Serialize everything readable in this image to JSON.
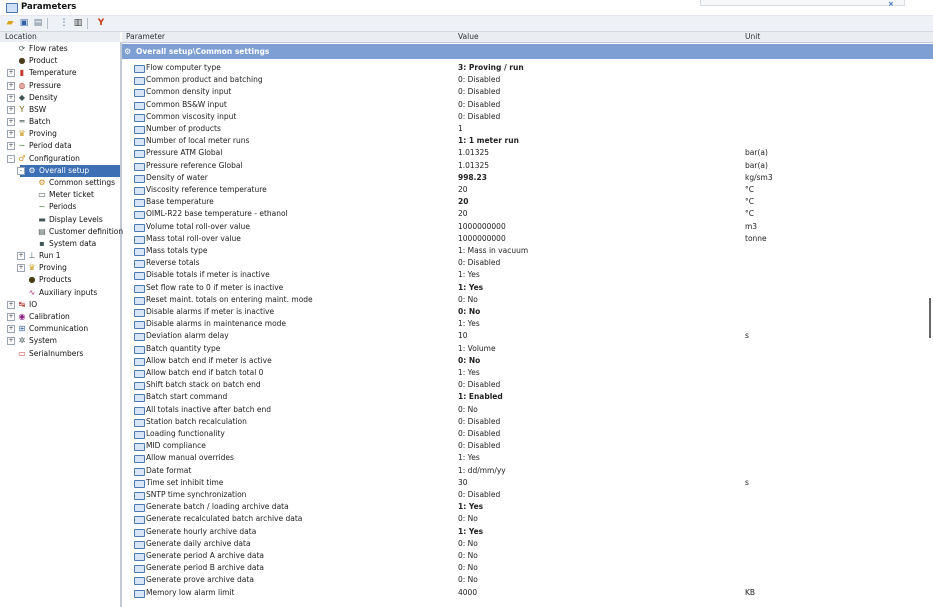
{
  "window": {
    "title": "Parameters"
  },
  "toolbar": {
    "icons": [
      "open-folder-icon",
      "save-icon",
      "print-icon",
      "tree-view-icon",
      "columns-icon",
      "filter-clear-icon"
    ]
  },
  "columns": {
    "location": "Location",
    "parameter": "Parameter",
    "value": "Value",
    "unit": "Unit"
  },
  "tree": [
    {
      "label": "Flow rates",
      "indent": 0,
      "exp": "",
      "icon": "flow-icon"
    },
    {
      "label": "Product",
      "indent": 0,
      "exp": "",
      "icon": "drop-icon"
    },
    {
      "label": "Temperature",
      "indent": 0,
      "exp": "+",
      "icon": "thermometer-icon"
    },
    {
      "label": "Pressure",
      "indent": 0,
      "exp": "+",
      "icon": "gauge-icon"
    },
    {
      "label": "Density",
      "indent": 0,
      "exp": "+",
      "icon": "density-icon"
    },
    {
      "label": "BSW",
      "indent": 0,
      "exp": "+",
      "icon": "funnel-icon"
    },
    {
      "label": "Batch",
      "indent": 0,
      "exp": "+",
      "icon": "batch-icon"
    },
    {
      "label": "Proving",
      "indent": 0,
      "exp": "+",
      "icon": "trophy-icon"
    },
    {
      "label": "Period data",
      "indent": 0,
      "exp": "+",
      "icon": "period-icon"
    },
    {
      "label": "Configuration",
      "indent": 0,
      "exp": "-",
      "icon": "config-icon"
    },
    {
      "label": "Overall setup",
      "indent": 1,
      "exp": "-",
      "icon": "setup-icon",
      "selected": true
    },
    {
      "label": "Common settings",
      "indent": 2,
      "exp": "",
      "icon": "settings-icon"
    },
    {
      "label": "Meter ticket",
      "indent": 2,
      "exp": "",
      "icon": "ticket-icon"
    },
    {
      "label": "Periods",
      "indent": 2,
      "exp": "",
      "icon": "period-icon"
    },
    {
      "label": "Display Levels",
      "indent": 2,
      "exp": "",
      "icon": "display-icon"
    },
    {
      "label": "Customer definition",
      "indent": 2,
      "exp": "",
      "icon": "document-icon"
    },
    {
      "label": "System data",
      "indent": 2,
      "exp": "",
      "icon": "system-icon"
    },
    {
      "label": "Run 1",
      "indent": 1,
      "exp": "+",
      "icon": "run-icon"
    },
    {
      "label": "Proving",
      "indent": 1,
      "exp": "+",
      "icon": "trophy-icon"
    },
    {
      "label": "Products",
      "indent": 1,
      "exp": "",
      "icon": "drop-icon"
    },
    {
      "label": "Auxiliary inputs",
      "indent": 1,
      "exp": "",
      "icon": "wave-icon"
    },
    {
      "label": "IO",
      "indent": 0,
      "exp": "+",
      "icon": "io-icon"
    },
    {
      "label": "Calibration",
      "indent": 0,
      "exp": "+",
      "icon": "calibration-icon"
    },
    {
      "label": "Communication",
      "indent": 0,
      "exp": "+",
      "icon": "network-icon"
    },
    {
      "label": "System",
      "indent": 0,
      "exp": "+",
      "icon": "gear-icon"
    },
    {
      "label": "Serialnumbers",
      "indent": 0,
      "exp": "",
      "icon": "serial-icon"
    }
  ],
  "group": {
    "title": "Overall setup\\Common settings"
  },
  "params": [
    {
      "name": "Flow computer type",
      "value": "3: Proving / run",
      "unit": "",
      "bold": true
    },
    {
      "name": "Common product and batching",
      "value": "0: Disabled",
      "unit": "",
      "bold": false
    },
    {
      "name": "Common density input",
      "value": "0: Disabled",
      "unit": "",
      "bold": false
    },
    {
      "name": "Common BS&W input",
      "value": "0: Disabled",
      "unit": "",
      "bold": false
    },
    {
      "name": "Common viscosity input",
      "value": "0: Disabled",
      "unit": "",
      "bold": false
    },
    {
      "name": "Number of products",
      "value": "1",
      "unit": "",
      "bold": false
    },
    {
      "name": "Number of local meter runs",
      "value": "1: 1 meter run",
      "unit": "",
      "bold": true
    },
    {
      "name": "Pressure ATM Global",
      "value": "1.01325",
      "unit": "bar(a)",
      "bold": false
    },
    {
      "name": "Pressure reference Global",
      "value": "1.01325",
      "unit": "bar(a)",
      "bold": false
    },
    {
      "name": "Density of water",
      "value": "998.23",
      "unit": "kg/sm3",
      "bold": true
    },
    {
      "name": "Viscosity reference temperature",
      "value": "20",
      "unit": "°C",
      "bold": false
    },
    {
      "name": "Base temperature",
      "value": "20",
      "unit": "°C",
      "bold": true
    },
    {
      "name": "OIML-R22 base temperature - ethanol",
      "value": "20",
      "unit": "°C",
      "bold": false
    },
    {
      "name": "Volume total roll-over value",
      "value": "1000000000",
      "unit": "m3",
      "bold": false
    },
    {
      "name": "Mass total roll-over value",
      "value": "1000000000",
      "unit": "tonne",
      "bold": false
    },
    {
      "name": "Mass totals type",
      "value": "1: Mass in vacuum",
      "unit": "",
      "bold": false
    },
    {
      "name": "Reverse totals",
      "value": "0: Disabled",
      "unit": "",
      "bold": false
    },
    {
      "name": "Disable totals if meter is inactive",
      "value": "1: Yes",
      "unit": "",
      "bold": false
    },
    {
      "name": "Set flow rate to 0 if meter is inactive",
      "value": "1: Yes",
      "unit": "",
      "bold": true
    },
    {
      "name": "Reset maint. totals on entering maint. mode",
      "value": "0: No",
      "unit": "",
      "bold": false
    },
    {
      "name": "Disable alarms if meter is inactive",
      "value": "0: No",
      "unit": "",
      "bold": true
    },
    {
      "name": "Disable alarms in maintenance mode",
      "value": "1: Yes",
      "unit": "",
      "bold": false
    },
    {
      "name": "Deviation alarm delay",
      "value": "10",
      "unit": "s",
      "bold": false
    },
    {
      "name": "Batch quantity type",
      "value": "1: Volume",
      "unit": "",
      "bold": false
    },
    {
      "name": "Allow batch end if meter is active",
      "value": "0: No",
      "unit": "",
      "bold": true
    },
    {
      "name": "Allow batch end if batch total 0",
      "value": "1: Yes",
      "unit": "",
      "bold": false
    },
    {
      "name": "Shift batch stack on batch end",
      "value": "0: Disabled",
      "unit": "",
      "bold": false
    },
    {
      "name": "Batch start command",
      "value": "1: Enabled",
      "unit": "",
      "bold": true
    },
    {
      "name": "All totals inactive after batch end",
      "value": "0: No",
      "unit": "",
      "bold": false
    },
    {
      "name": "Station batch recalculation",
      "value": "0: Disabled",
      "unit": "",
      "bold": false
    },
    {
      "name": "Loading functionality",
      "value": "0: Disabled",
      "unit": "",
      "bold": false
    },
    {
      "name": "MID compliance",
      "value": "0: Disabled",
      "unit": "",
      "bold": false
    },
    {
      "name": "Allow manual overrides",
      "value": "1: Yes",
      "unit": "",
      "bold": false
    },
    {
      "name": "Date format",
      "value": "1: dd/mm/yy",
      "unit": "",
      "bold": false
    },
    {
      "name": "Time set inhibit time",
      "value": "30",
      "unit": "s",
      "bold": false
    },
    {
      "name": "SNTP time synchronization",
      "value": "0: Disabled",
      "unit": "",
      "bold": false
    },
    {
      "name": "Generate batch / loading archive data",
      "value": "1: Yes",
      "unit": "",
      "bold": true
    },
    {
      "name": "Generate recalculated batch archive data",
      "value": "0: No",
      "unit": "",
      "bold": false
    },
    {
      "name": "Generate hourly archive data",
      "value": "1: Yes",
      "unit": "",
      "bold": true
    },
    {
      "name": "Generate daily archive data",
      "value": "0: No",
      "unit": "",
      "bold": false
    },
    {
      "name": "Generate period A archive data",
      "value": "0: No",
      "unit": "",
      "bold": false
    },
    {
      "name": "Generate period B archive data",
      "value": "0: No",
      "unit": "",
      "bold": false
    },
    {
      "name": "Generate prove archive data",
      "value": "0: No",
      "unit": "",
      "bold": false
    },
    {
      "name": "Memory low alarm limit",
      "value": "4000",
      "unit": "KB",
      "bold": false
    }
  ]
}
